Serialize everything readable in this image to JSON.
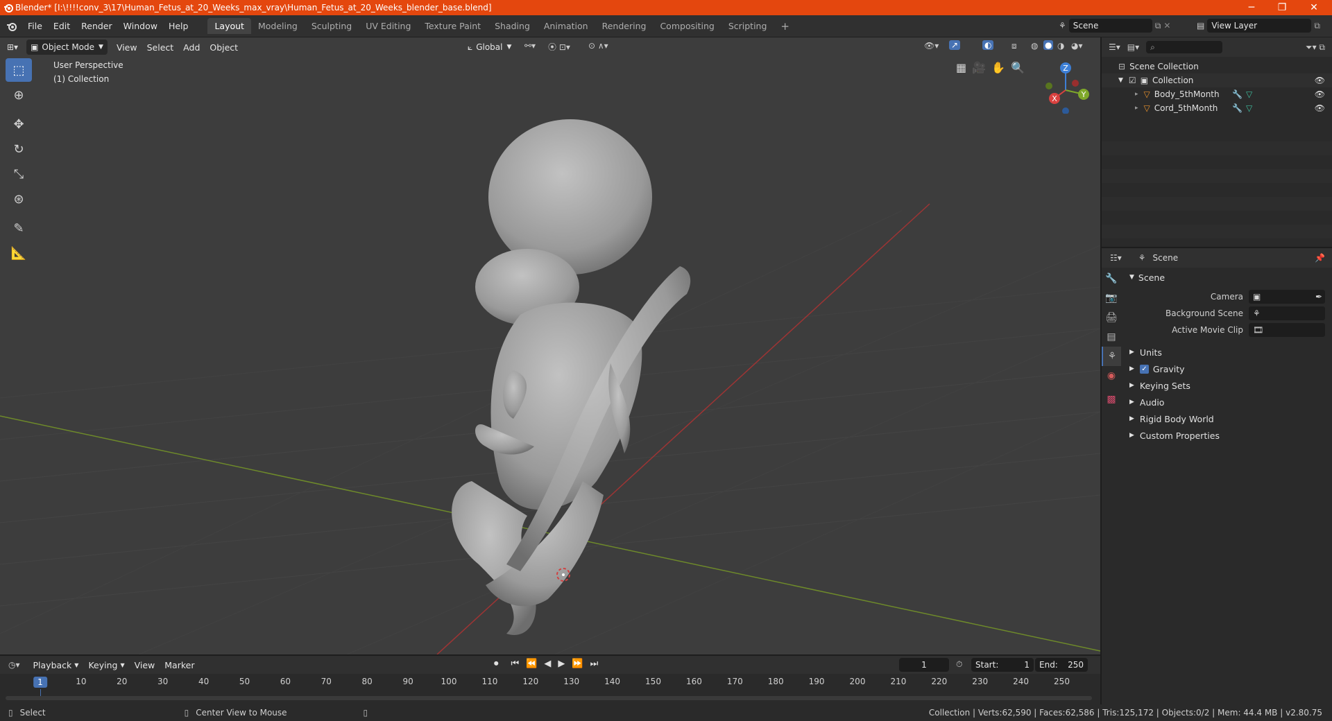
{
  "window": {
    "title": "Blender* [I:\\!!!!conv_3\\17\\Human_Fetus_at_20_Weeks_max_vray\\Human_Fetus_at_20_Weeks_blender_base.blend]",
    "minimize": "─",
    "maximize": "❐",
    "close": "✕"
  },
  "menus": [
    "File",
    "Edit",
    "Render",
    "Window",
    "Help"
  ],
  "workspaces": [
    "Layout",
    "Modeling",
    "Sculpting",
    "UV Editing",
    "Texture Paint",
    "Shading",
    "Animation",
    "Rendering",
    "Compositing",
    "Scripting"
  ],
  "add_workspace": "+",
  "scene_selector": "Scene",
  "view_layer_selector": "View Layer",
  "viewport": {
    "mode": "Object Mode",
    "menus": [
      "View",
      "Select",
      "Add",
      "Object"
    ],
    "transform_orientation": "Global",
    "overlay_title": "User Perspective",
    "overlay_collection": "(1) Collection",
    "gizmo": {
      "x": "X",
      "y": "Y",
      "z": "Z"
    }
  },
  "outliner": {
    "search_placeholder": "",
    "root": "Scene Collection",
    "collection": "Collection",
    "objects": [
      "Body_5thMonth",
      "Cord_5thMonth"
    ]
  },
  "properties": {
    "context": "Scene",
    "panel": "Scene",
    "fields": [
      {
        "label": "Camera",
        "value": ""
      },
      {
        "label": "Background Scene",
        "value": ""
      },
      {
        "label": "Active Movie Clip",
        "value": ""
      }
    ],
    "subpanels": [
      "Units",
      "Gravity",
      "Keying Sets",
      "Audio",
      "Rigid Body World",
      "Custom Properties"
    ],
    "gravity_checked": true
  },
  "timeline": {
    "menus": [
      "Playback",
      "Keying",
      "View",
      "Marker"
    ],
    "current_frame": "1",
    "start_label": "Start:",
    "start": "1",
    "end_label": "End:",
    "end": "250",
    "ticks": [
      "1",
      "10",
      "20",
      "30",
      "40",
      "50",
      "60",
      "70",
      "80",
      "90",
      "100",
      "110",
      "120",
      "130",
      "140",
      "150",
      "160",
      "170",
      "180",
      "190",
      "200",
      "210",
      "220",
      "230",
      "240",
      "250"
    ]
  },
  "status": {
    "left": "Select",
    "middle": "Center View to Mouse",
    "right": "Collection | Verts:62,590 | Faces:62,586 | Tris:125,172 | Objects:0/2 | Mem: 44.4 MB | v2.80.75"
  },
  "colors": {
    "title_bar": "#e4470e",
    "accent": "#4772b3",
    "axis_x": "#d9413f",
    "axis_y": "#7fa82a",
    "axis_z": "#3d7fd6"
  }
}
